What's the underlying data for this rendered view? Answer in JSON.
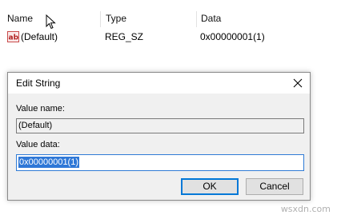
{
  "list": {
    "columns": [
      {
        "label": "Name"
      },
      {
        "label": "Type"
      },
      {
        "label": "Data"
      }
    ],
    "row": {
      "icon": "ab-string-value-icon",
      "name": "(Default)",
      "type": "REG_SZ",
      "data": "0x00000001(1)"
    }
  },
  "dialog": {
    "title": "Edit String",
    "close_icon": "close-icon",
    "value_name_label": "Value name:",
    "value_name": "(Default)",
    "value_data_label": "Value data:",
    "value_data": "0x00000001(1)",
    "ok_label": "OK",
    "cancel_label": "Cancel"
  },
  "watermark": "wsxdn.com",
  "colors": {
    "selection": "#2f78d7",
    "focus_border": "#0078d7",
    "dialog_body": "#f0f0f0"
  }
}
